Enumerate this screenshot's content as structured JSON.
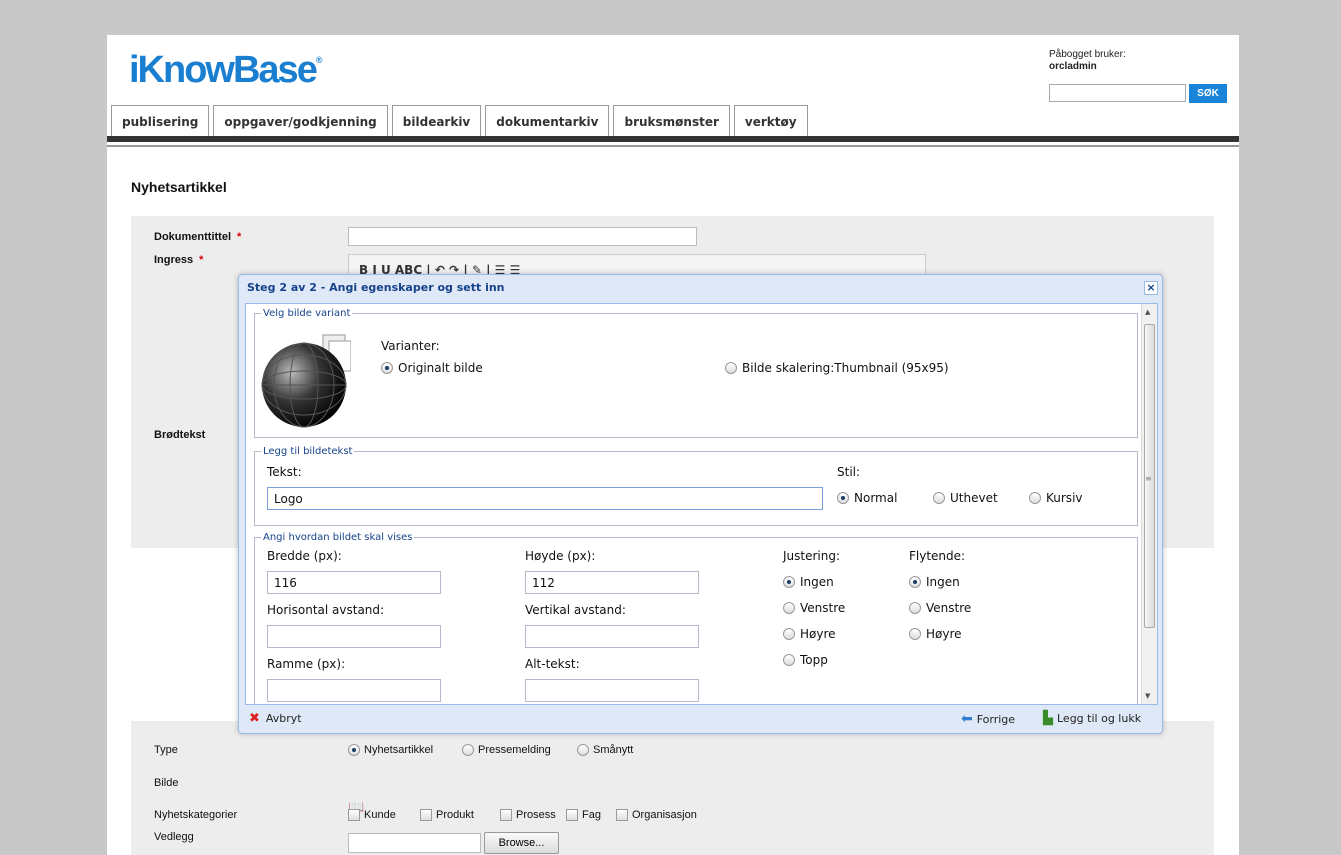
{
  "header": {
    "logo_text": "iKnowBase",
    "logo_mark": "®",
    "logged_in_label": "Påbogget bruker:",
    "username": "orcladmin",
    "search_button": "SØK"
  },
  "tabs": [
    "publisering",
    "oppgaver/godkjenning",
    "bildearkiv",
    "dokumentarkiv",
    "bruksmønster",
    "verktøy"
  ],
  "page_title": "Nyhetsartikkel",
  "form": {
    "doc_title_label": "Dokumenttittel",
    "ingress_label": "Ingress",
    "required_mark": "*",
    "body_label": "Brødtekst",
    "toolbar_text": "B  I  U  ABC  |  ↶  ↷  |  ✎  |  ☰  ☰",
    "type_label": "Type",
    "type_options": [
      "Nyhetsartikkel",
      "Pressemelding",
      "Smånytt"
    ],
    "image_label": "Bilde",
    "category_label": "Nyhetskategorier",
    "categories": [
      "Kunde",
      "Produkt",
      "Prosess",
      "Fag",
      "Organisasjon"
    ],
    "attachment_label": "Vedlegg",
    "browse_button": "Browse..."
  },
  "dialog": {
    "title": "Steg 2 av 2 - Angi egenskaper og sett inn",
    "close": "×",
    "variant_legend": "Velg bilde variant",
    "variants_label": "Varianter:",
    "variant_options": [
      "Originalt bilde",
      "Bilde skalering:Thumbnail (95x95)"
    ],
    "caption_legend": "Legg til bildetekst",
    "text_label": "Tekst:",
    "text_value": "Logo",
    "style_label": "Stil:",
    "style_options": [
      "Normal",
      "Uthevet",
      "Kursiv"
    ],
    "display_legend": "Angi hvordan bildet skal vises",
    "width_label": "Bredde (px):",
    "width_value": "116",
    "height_label": "Høyde (px):",
    "height_value": "112",
    "hspace_label": "Horisontal avstand:",
    "vspace_label": "Vertikal avstand:",
    "border_label": "Ramme (px):",
    "alt_label": "Alt-tekst:",
    "align_label": "Justering:",
    "align_options": [
      "Ingen",
      "Venstre",
      "Høyre",
      "Topp"
    ],
    "float_label": "Flytende:",
    "float_options": [
      "Ingen",
      "Venstre",
      "Høyre"
    ],
    "cancel": "Avbryt",
    "previous": "Forrige",
    "insert_close": "Legg til og lukk"
  },
  "colors": {
    "accent": "#1a7fd0",
    "dialog_title": "#15428b"
  }
}
